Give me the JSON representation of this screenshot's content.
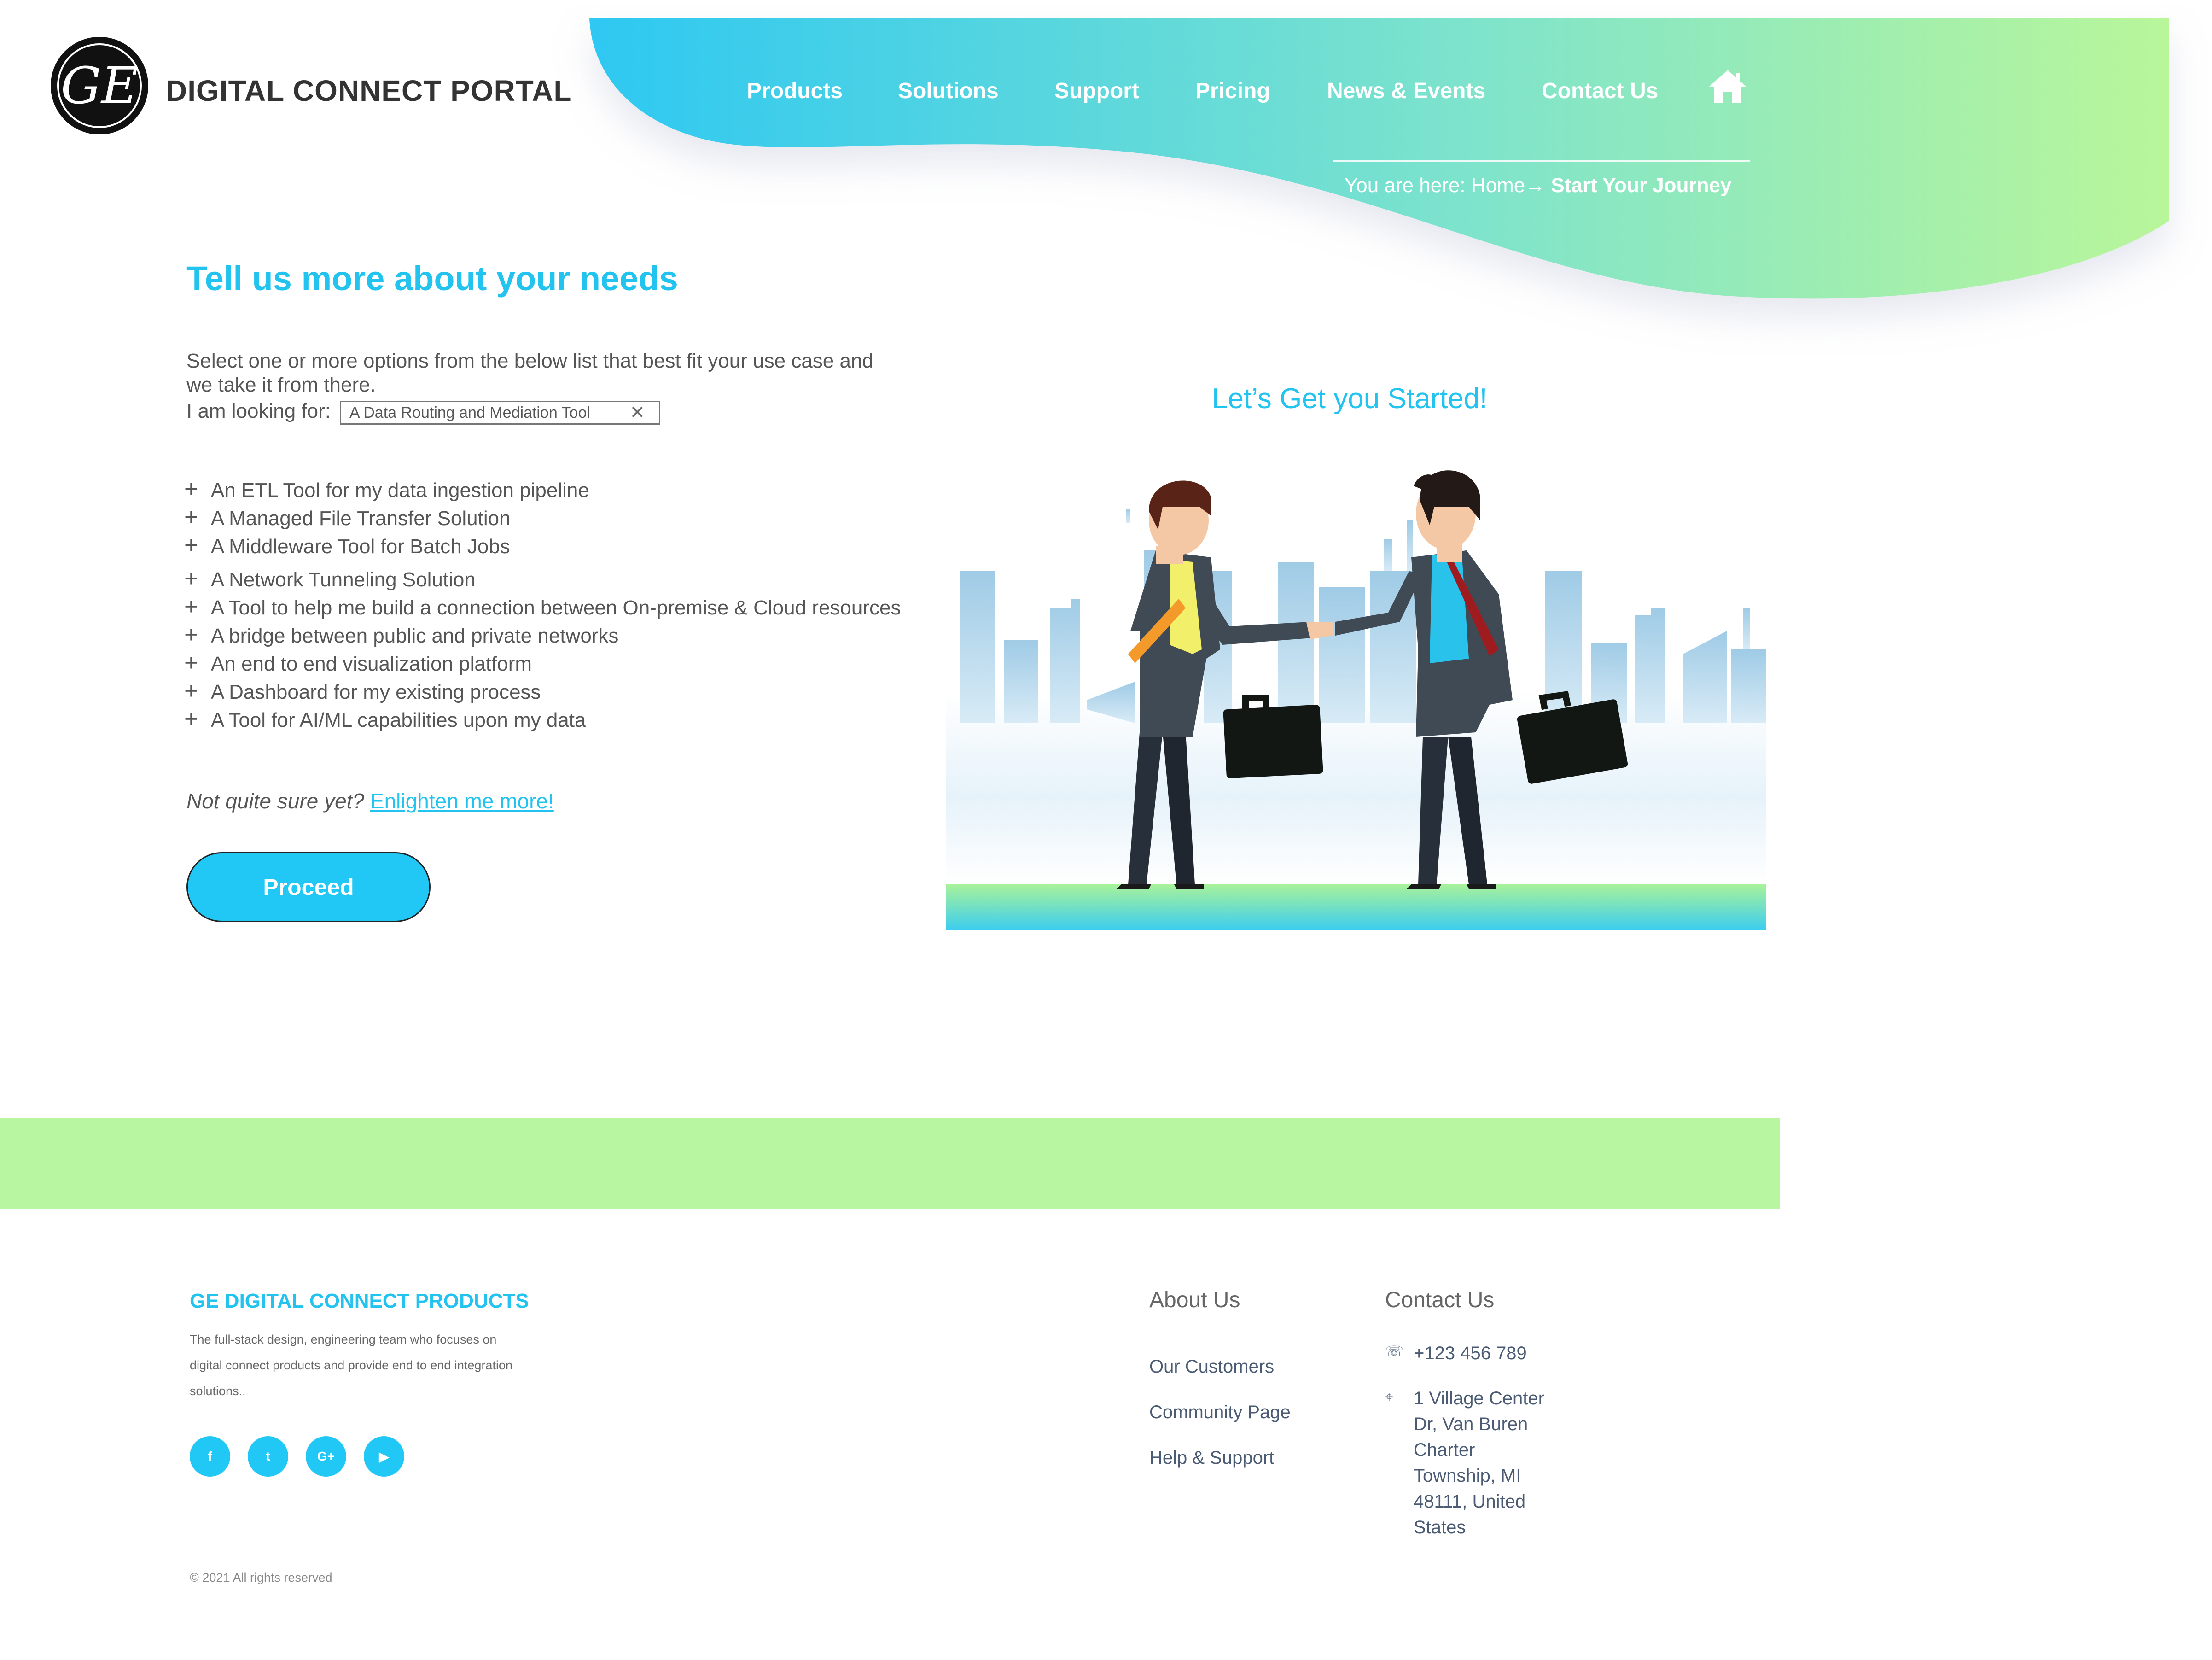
{
  "header": {
    "brand": "DIGITAL CONNECT PORTAL",
    "nav": [
      "Products",
      "Solutions",
      "Support",
      "Pricing",
      "News & Events",
      "Contact Us"
    ],
    "breadcrumb": {
      "prefix": "You are here: ",
      "home": "Home",
      "arrow": "→",
      "current": "Start Your Journey"
    }
  },
  "main": {
    "heading": "Tell us more about your needs",
    "intro": "Select one or more options from the below list that best fit your use case and we take it from there.",
    "looking_label": "I am looking for:",
    "selected_chip": "A Data Routing and Mediation Tool",
    "options": [
      "An ETL Tool for my data ingestion pipeline",
      "A Managed File Transfer Solution",
      "A Middleware Tool for Batch Jobs",
      "A Network Tunneling Solution",
      "A Tool to help me build a connection between On-premise & Cloud resources",
      "A bridge between public and private networks",
      "An end to end visualization platform",
      "A Dashboard for my existing process",
      "A Tool for AI/ML capabilities upon my data"
    ],
    "unsure_text": "Not quite sure yet? ",
    "unsure_link": "Enlighten me more!",
    "proceed": "Proceed",
    "illustration_title": "Let’s Get you Started!"
  },
  "footer": {
    "title": "GE DIGITAL CONNECT PRODUCTS",
    "description": "The full-stack design, engineering team who focuses on digital connect products and provide end to end integration solutions..",
    "social": [
      "f",
      "t",
      "G+",
      "▶"
    ],
    "about_heading": "About Us",
    "about_links": [
      "Our Customers",
      "Community Page",
      "Help & Support"
    ],
    "contact_heading": "Contact Us",
    "phone": "+123 456 789",
    "address_lines": [
      "1 Village Center",
      "Dr, Van Buren",
      "Charter",
      "Township, MI",
      "48111, United",
      "States"
    ],
    "copyright": "© 2021 All rights reserved"
  },
  "colors": {
    "accent": "#22c3ee",
    "wave_start": "#2ec8f2",
    "wave_end": "#b9f69a",
    "band": "#b9f6a2"
  }
}
